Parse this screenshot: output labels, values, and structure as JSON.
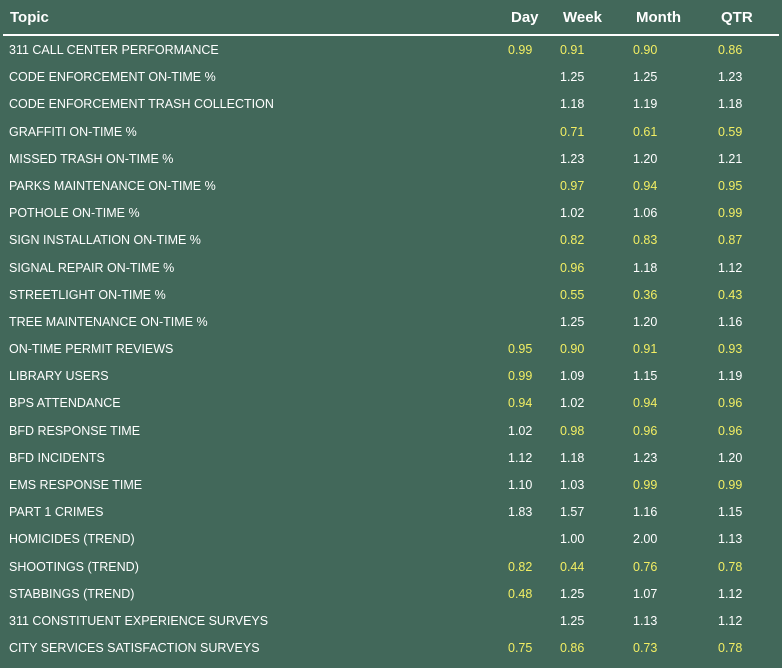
{
  "colors": {
    "background": "#42685a",
    "text_white": "#ffffff",
    "text_yellow": "#f2ee63",
    "divider": "#ffffff"
  },
  "header": {
    "topic": "Topic",
    "day": "Day",
    "week": "Week",
    "month": "Month",
    "qtr": "QTR"
  },
  "rows": [
    {
      "topic": "311 CALL CENTER PERFORMANCE",
      "day": {
        "value": "0.99",
        "status": "yellow"
      },
      "week": {
        "value": "0.91",
        "status": "yellow"
      },
      "month": {
        "value": "0.90",
        "status": "yellow"
      },
      "qtr": {
        "value": "0.86",
        "status": "yellow"
      }
    },
    {
      "topic": "CODE ENFORCEMENT ON-TIME %",
      "day": {
        "value": "",
        "status": "white"
      },
      "week": {
        "value": "1.25",
        "status": "white"
      },
      "month": {
        "value": "1.25",
        "status": "white"
      },
      "qtr": {
        "value": "1.23",
        "status": "white"
      }
    },
    {
      "topic": "CODE ENFORCEMENT TRASH COLLECTION",
      "day": {
        "value": "",
        "status": "white"
      },
      "week": {
        "value": "1.18",
        "status": "white"
      },
      "month": {
        "value": "1.19",
        "status": "white"
      },
      "qtr": {
        "value": "1.18",
        "status": "white"
      }
    },
    {
      "topic": "GRAFFITI ON-TIME %",
      "day": {
        "value": "",
        "status": "white"
      },
      "week": {
        "value": "0.71",
        "status": "yellow"
      },
      "month": {
        "value": "0.61",
        "status": "yellow"
      },
      "qtr": {
        "value": "0.59",
        "status": "yellow"
      }
    },
    {
      "topic": "MISSED TRASH ON-TIME %",
      "day": {
        "value": "",
        "status": "white"
      },
      "week": {
        "value": "1.23",
        "status": "white"
      },
      "month": {
        "value": "1.20",
        "status": "white"
      },
      "qtr": {
        "value": "1.21",
        "status": "white"
      }
    },
    {
      "topic": "PARKS MAINTENANCE ON-TIME %",
      "day": {
        "value": "",
        "status": "white"
      },
      "week": {
        "value": "0.97",
        "status": "yellow"
      },
      "month": {
        "value": "0.94",
        "status": "yellow"
      },
      "qtr": {
        "value": "0.95",
        "status": "yellow"
      }
    },
    {
      "topic": "POTHOLE ON-TIME %",
      "day": {
        "value": "",
        "status": "white"
      },
      "week": {
        "value": "1.02",
        "status": "white"
      },
      "month": {
        "value": "1.06",
        "status": "white"
      },
      "qtr": {
        "value": "0.99",
        "status": "yellow"
      }
    },
    {
      "topic": "SIGN INSTALLATION ON-TIME %",
      "day": {
        "value": "",
        "status": "white"
      },
      "week": {
        "value": "0.82",
        "status": "yellow"
      },
      "month": {
        "value": "0.83",
        "status": "yellow"
      },
      "qtr": {
        "value": "0.87",
        "status": "yellow"
      }
    },
    {
      "topic": "SIGNAL REPAIR ON-TIME %",
      "day": {
        "value": "",
        "status": "white"
      },
      "week": {
        "value": "0.96",
        "status": "yellow"
      },
      "month": {
        "value": "1.18",
        "status": "white"
      },
      "qtr": {
        "value": "1.12",
        "status": "white"
      }
    },
    {
      "topic": "STREETLIGHT ON-TIME %",
      "day": {
        "value": "",
        "status": "white"
      },
      "week": {
        "value": "0.55",
        "status": "yellow"
      },
      "month": {
        "value": "0.36",
        "status": "yellow"
      },
      "qtr": {
        "value": "0.43",
        "status": "yellow"
      }
    },
    {
      "topic": "TREE MAINTENANCE ON-TIME %",
      "day": {
        "value": "",
        "status": "white"
      },
      "week": {
        "value": "1.25",
        "status": "white"
      },
      "month": {
        "value": "1.20",
        "status": "white"
      },
      "qtr": {
        "value": "1.16",
        "status": "white"
      }
    },
    {
      "topic": "ON-TIME PERMIT REVIEWS",
      "day": {
        "value": "0.95",
        "status": "yellow"
      },
      "week": {
        "value": "0.90",
        "status": "yellow"
      },
      "month": {
        "value": "0.91",
        "status": "yellow"
      },
      "qtr": {
        "value": "0.93",
        "status": "yellow"
      }
    },
    {
      "topic": "LIBRARY USERS",
      "day": {
        "value": "0.99",
        "status": "yellow"
      },
      "week": {
        "value": "1.09",
        "status": "white"
      },
      "month": {
        "value": "1.15",
        "status": "white"
      },
      "qtr": {
        "value": "1.19",
        "status": "white"
      }
    },
    {
      "topic": "BPS ATTENDANCE",
      "day": {
        "value": "0.94",
        "status": "yellow"
      },
      "week": {
        "value": "1.02",
        "status": "white"
      },
      "month": {
        "value": "0.94",
        "status": "yellow"
      },
      "qtr": {
        "value": "0.96",
        "status": "yellow"
      }
    },
    {
      "topic": "BFD RESPONSE TIME",
      "day": {
        "value": "1.02",
        "status": "white"
      },
      "week": {
        "value": "0.98",
        "status": "yellow"
      },
      "month": {
        "value": "0.96",
        "status": "yellow"
      },
      "qtr": {
        "value": "0.96",
        "status": "yellow"
      }
    },
    {
      "topic": "BFD INCIDENTS",
      "day": {
        "value": "1.12",
        "status": "white"
      },
      "week": {
        "value": "1.18",
        "status": "white"
      },
      "month": {
        "value": "1.23",
        "status": "white"
      },
      "qtr": {
        "value": "1.20",
        "status": "white"
      }
    },
    {
      "topic": "EMS RESPONSE TIME",
      "day": {
        "value": "1.10",
        "status": "white"
      },
      "week": {
        "value": "1.03",
        "status": "white"
      },
      "month": {
        "value": "0.99",
        "status": "yellow"
      },
      "qtr": {
        "value": "0.99",
        "status": "yellow"
      }
    },
    {
      "topic": "PART 1 CRIMES",
      "day": {
        "value": "1.83",
        "status": "white"
      },
      "week": {
        "value": "1.57",
        "status": "white"
      },
      "month": {
        "value": "1.16",
        "status": "white"
      },
      "qtr": {
        "value": "1.15",
        "status": "white"
      }
    },
    {
      "topic": "HOMICIDES (TREND)",
      "day": {
        "value": "",
        "status": "white"
      },
      "week": {
        "value": "1.00",
        "status": "white"
      },
      "month": {
        "value": "2.00",
        "status": "white"
      },
      "qtr": {
        "value": "1.13",
        "status": "white"
      }
    },
    {
      "topic": "SHOOTINGS (TREND)",
      "day": {
        "value": "0.82",
        "status": "yellow"
      },
      "week": {
        "value": "0.44",
        "status": "yellow"
      },
      "month": {
        "value": "0.76",
        "status": "yellow"
      },
      "qtr": {
        "value": "0.78",
        "status": "yellow"
      }
    },
    {
      "topic": "STABBINGS (TREND)",
      "day": {
        "value": "0.48",
        "status": "yellow"
      },
      "week": {
        "value": "1.25",
        "status": "white"
      },
      "month": {
        "value": "1.07",
        "status": "white"
      },
      "qtr": {
        "value": "1.12",
        "status": "white"
      }
    },
    {
      "topic": "311 CONSTITUENT EXPERIENCE SURVEYS",
      "day": {
        "value": "",
        "status": "white"
      },
      "week": {
        "value": "1.25",
        "status": "white"
      },
      "month": {
        "value": "1.13",
        "status": "white"
      },
      "qtr": {
        "value": "1.12",
        "status": "white"
      }
    },
    {
      "topic": "CITY SERVICES SATISFACTION SURVEYS",
      "day": {
        "value": "0.75",
        "status": "yellow"
      },
      "week": {
        "value": "0.86",
        "status": "yellow"
      },
      "month": {
        "value": "0.73",
        "status": "yellow"
      },
      "qtr": {
        "value": "0.78",
        "status": "yellow"
      }
    }
  ]
}
